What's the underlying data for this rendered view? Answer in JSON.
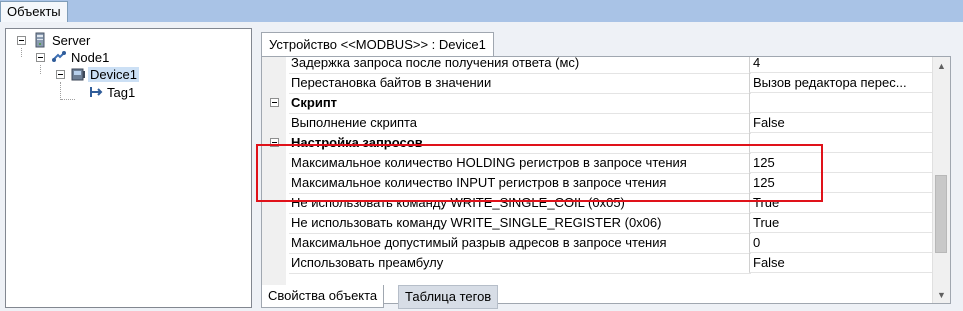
{
  "window": {
    "tab_label": "Объекты"
  },
  "tree": {
    "nodes": [
      {
        "label": "Server",
        "icon": "server-icon"
      },
      {
        "label": "Node1",
        "icon": "node-icon"
      },
      {
        "label": "Device1",
        "icon": "device-icon",
        "selected": true
      },
      {
        "label": "Tag1",
        "icon": "tag-icon"
      }
    ]
  },
  "document": {
    "tab_label": "Устройство <<MODBUS>> : Device1"
  },
  "properties": {
    "rows": [
      {
        "name": "Задержка запроса после получения ответа (мс)",
        "value": "4"
      },
      {
        "name": "Перестановка байтов в значении",
        "value": "Вызов редактора перес..."
      },
      {
        "name": "Скрипт",
        "value": "",
        "category": true
      },
      {
        "name": "Выполнение скрипта",
        "value": "False"
      },
      {
        "name": "Настройка запросов",
        "value": "",
        "category": true
      },
      {
        "name": "Максимальное количество HOLDING регистров в запросе чтения",
        "value": "125"
      },
      {
        "name": "Максимальное количество INPUT регистров в запросе чтения",
        "value": "125"
      },
      {
        "name": "Не использовать команду WRITE_SINGLE_COIL (0x05)",
        "value": "True"
      },
      {
        "name": "Не использовать команду WRITE_SINGLE_REGISTER (0x06)",
        "value": "True"
      },
      {
        "name": "Максимальное допустимый разрыв адресов в запросе чтения",
        "value": "0"
      },
      {
        "name": "Использовать преамбулу",
        "value": "False"
      }
    ]
  },
  "bottom_tabs": {
    "properties_label": "Свойства объекта",
    "tags_label": "Таблица тегов"
  },
  "colors": {
    "highlight": "#e0121a",
    "selection": "#cce0f5"
  }
}
